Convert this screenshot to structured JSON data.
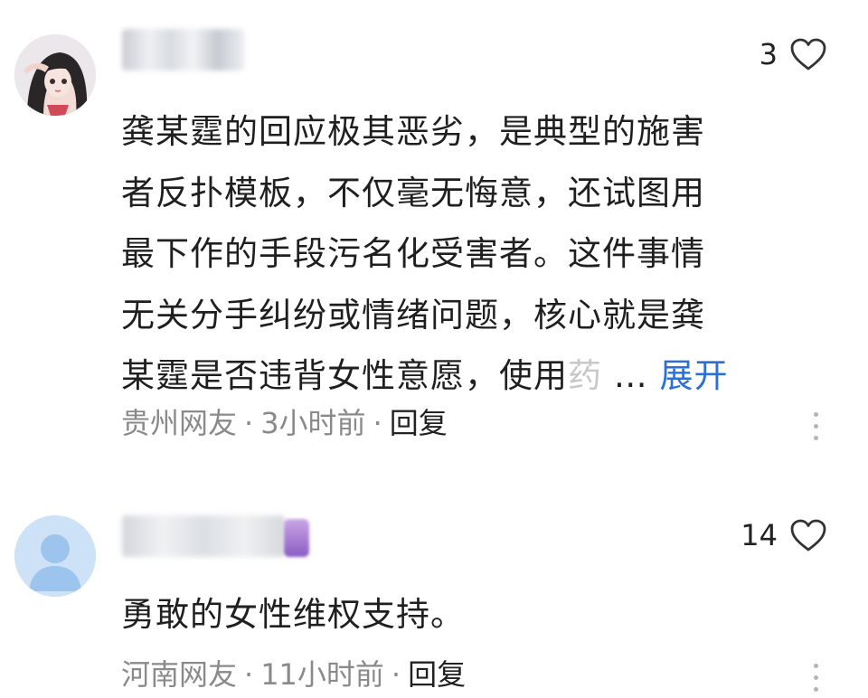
{
  "comments": [
    {
      "likes": "3",
      "lines": [
        "龚某霆的回应极其恶劣，是典型的施害",
        "者反扑模板，不仅毫无悔意，还试图用",
        "最下作的手段污名化受害者。这件事情",
        "无关分手纠纷或情绪问题，核心就是龚"
      ],
      "last_line": "某霆是否违背女性意愿，使用",
      "faded_text": "药",
      "ellipsis": " … ",
      "expand_label": "展开",
      "location": "贵州网友",
      "time": "3小时前",
      "reply_label": "回复",
      "icons": {
        "like": "heart-outline-icon",
        "more": "vertical-dots-icon"
      }
    },
    {
      "likes": "14",
      "lines": [
        "勇敢的女性维权支持。"
      ],
      "location": "河南网友",
      "time": "11小时前",
      "reply_label": "回复",
      "icons": {
        "like": "heart-outline-icon",
        "more": "vertical-dots-icon"
      }
    }
  ],
  "separator": "·"
}
